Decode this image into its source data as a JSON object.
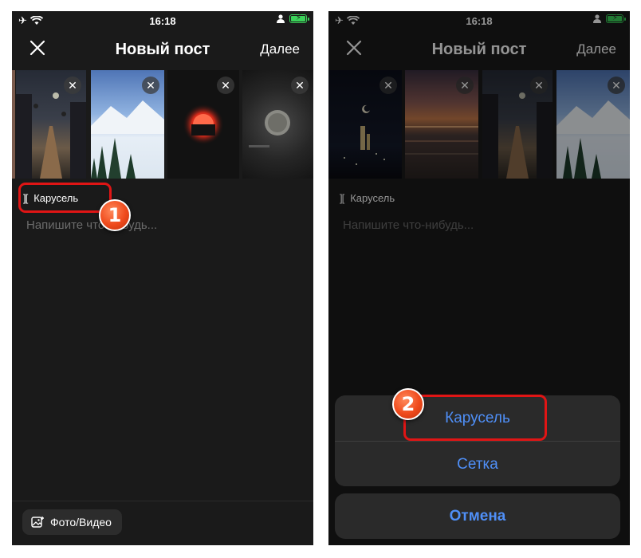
{
  "status": {
    "time": "16:18"
  },
  "left": {
    "title": "Новый пост",
    "next_label": "Далее",
    "mode_label": "Карусель",
    "mode_icon": "][",
    "caption_placeholder": "Напишите что-нибудь...",
    "media_button_label": "Фото/Видео",
    "step_marker": "1"
  },
  "right": {
    "title": "Новый пост",
    "next_label": "Далее",
    "mode_label": "Карусель",
    "mode_icon": "][",
    "caption_placeholder": "Напишите что-нибудь...",
    "sheet_options": [
      "Карусель",
      "Сетка"
    ],
    "cancel_label": "Отмена",
    "step_marker": "2"
  },
  "colors": {
    "accent": "#4f8ff7",
    "highlight": "#e01515",
    "marker": "#ef4a1c",
    "background": "#1a1a1a"
  },
  "icons": [
    "airplane-icon",
    "wifi-icon",
    "person-icon",
    "battery-icon",
    "close-icon",
    "carousel-icon",
    "photo-add-icon"
  ]
}
